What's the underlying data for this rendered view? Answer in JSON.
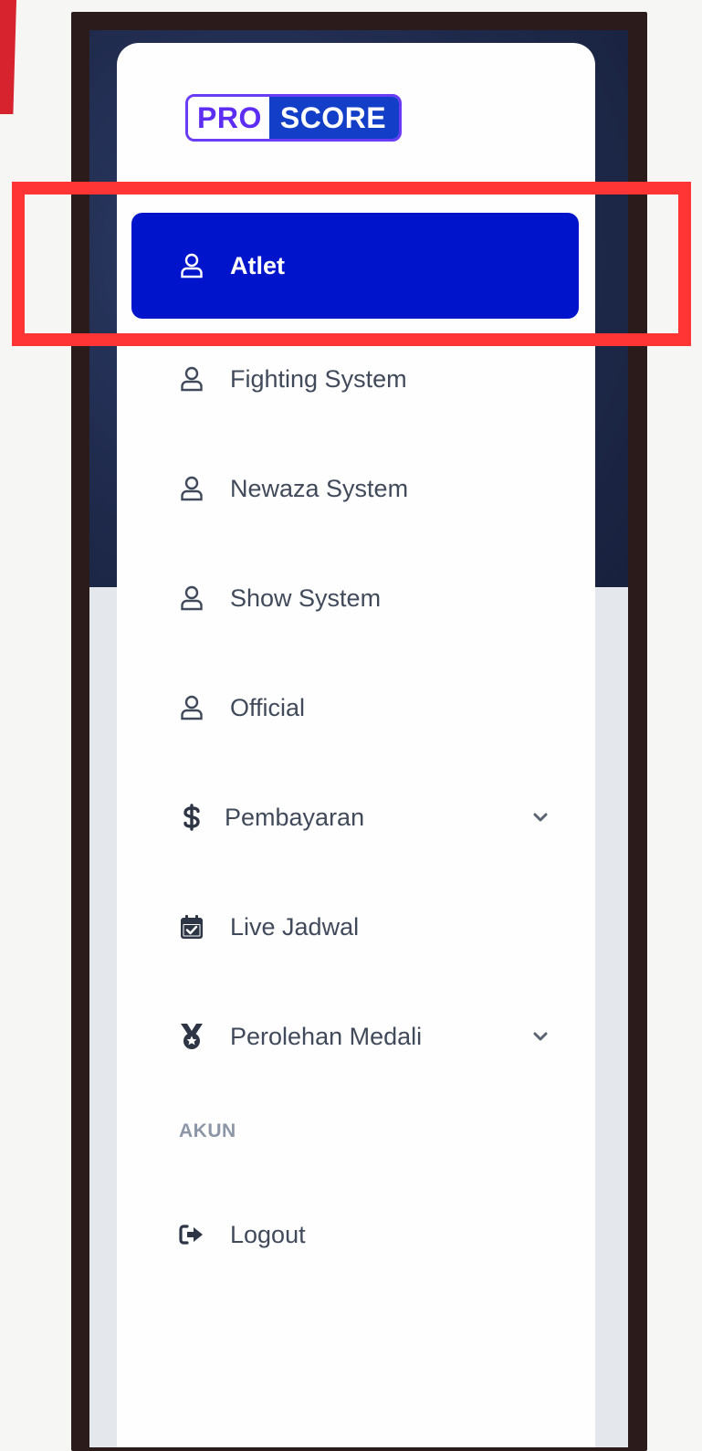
{
  "brand": {
    "pro": "PRO",
    "score": "SCORE",
    "pro_color": "#5d2ef2",
    "score_bg": "#123ec8"
  },
  "menu": {
    "active_bg": "#0014cc",
    "items": [
      {
        "label": "Atlet",
        "icon": "user-icon",
        "active": true
      },
      {
        "label": "Fighting System",
        "icon": "user-icon",
        "active": false
      },
      {
        "label": "Newaza System",
        "icon": "user-icon",
        "active": false
      },
      {
        "label": "Show System",
        "icon": "user-icon",
        "active": false
      },
      {
        "label": "Official",
        "icon": "user-icon",
        "active": false
      },
      {
        "label": "Pembayaran",
        "icon": "dollar-icon",
        "active": false,
        "expandable": true
      },
      {
        "label": "Live Jadwal",
        "icon": "calendar-check-icon",
        "active": false
      },
      {
        "label": "Perolehan Medali",
        "icon": "medal-icon",
        "active": false,
        "expandable": true
      }
    ]
  },
  "account": {
    "heading": "AKUN",
    "logout": {
      "label": "Logout",
      "icon": "logout-icon"
    }
  },
  "annotation": {
    "highlight_color": "#ff3434"
  }
}
